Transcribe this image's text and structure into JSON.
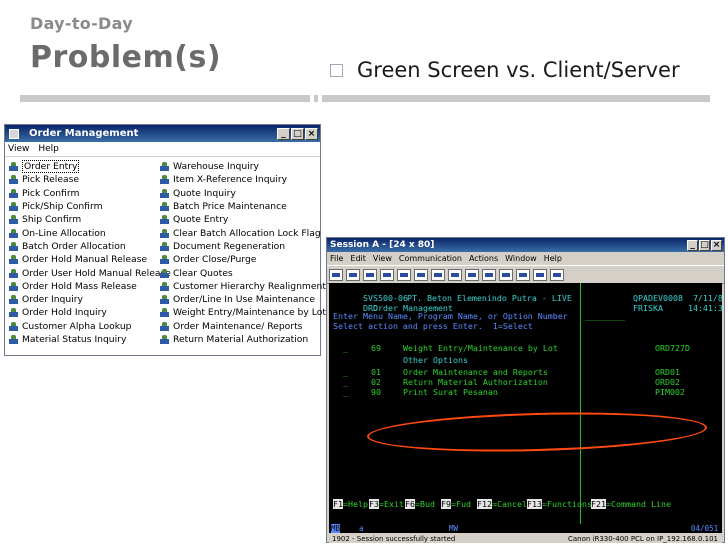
{
  "slide": {
    "kicker": "Day-to-Day",
    "title": "Problem(s)",
    "bullet": "Green Screen vs. Client/Server"
  },
  "order_window": {
    "title": "Order Management",
    "menu": [
      "View",
      "Help"
    ],
    "left_items": [
      "Order Entry",
      "Pick Release",
      "Pick Confirm",
      "Pick/Ship Confirm",
      "Ship Confirm",
      "On-Line Allocation",
      "Batch Order Allocation",
      "Order Hold Manual Release",
      "Order User Hold Manual Release",
      "Order Hold Mass Release",
      "Order Inquiry",
      "Order Hold Inquiry",
      "Customer Alpha Lookup",
      "Material Status Inquiry"
    ],
    "right_items": [
      "Warehouse Inquiry",
      "Item X-Reference Inquiry",
      "Quote Inquiry",
      "Batch Price Maintenance",
      "Quote Entry",
      "Clear Batch Allocation Lock Flag",
      "Document Regeneration",
      "Order Close/Purge",
      "Clear Quotes",
      "Customer Hierarchy Realignment",
      "Order/Line In Use Maintenance",
      "Weight Entry/Maintenance by Lot",
      "Order Maintenance/ Reports",
      "Return Material Authorization"
    ]
  },
  "session_window": {
    "title": "Session A - [24 x 80]",
    "menu": [
      "File",
      "Edit",
      "View",
      "Communication",
      "Actions",
      "Window",
      "Help"
    ],
    "header_left1": "SVS500-06",
    "header_center1": "PT. Beton Elemenindo Putra - LIVE",
    "header_right1": "QPADEV0008  7/11/8",
    "header_left2": "DRD",
    "header_center2": "Order Management",
    "header_right2": "FRISKA     14:41:3",
    "prompt": "Enter Menu Name, Program Name, or Option Number",
    "instruction": "Select action and press Enter.  1=Select",
    "rows": [
      {
        "sel": "_",
        "num": "69",
        "desc": "Weight Entry/Maintenance by Lot",
        "code": "ORD727D"
      },
      {
        "sel": "",
        "num": "",
        "desc": "Other Options",
        "code": ""
      },
      {
        "sel": "_",
        "num": "01",
        "desc": "Order Maintenance and Reports",
        "code": "ORD01"
      },
      {
        "sel": "_",
        "num": "02",
        "desc": "Return Material Authorization",
        "code": "ORD02"
      },
      {
        "sel": "_",
        "num": "90",
        "desc": "Print Surat Pesanan",
        "code": "PIM002"
      }
    ],
    "fkeys": [
      {
        "key": "F1",
        "label": "=Help"
      },
      {
        "key": "F3",
        "label": "=Exit"
      },
      {
        "key": "F6",
        "label": "=Bud"
      },
      {
        "key": "F9",
        "label": "=Fud"
      },
      {
        "key": "F12",
        "label": "=Cancel"
      },
      {
        "key": "F13",
        "label": "=Functions"
      },
      {
        "key": "F21",
        "label": "=Command Line"
      }
    ],
    "oia_left": "MB",
    "oia_a": "a",
    "oia_mw": "MW",
    "oia_pos": "04/051",
    "status_left": "1902 - Session successfully started",
    "status_right": "Canon iR330-400 PCL on IP_192.168.0.101"
  },
  "colors": {
    "title_gray": "#6b6b6b",
    "green": "#2fd12f",
    "oval": "#ff4a10"
  }
}
